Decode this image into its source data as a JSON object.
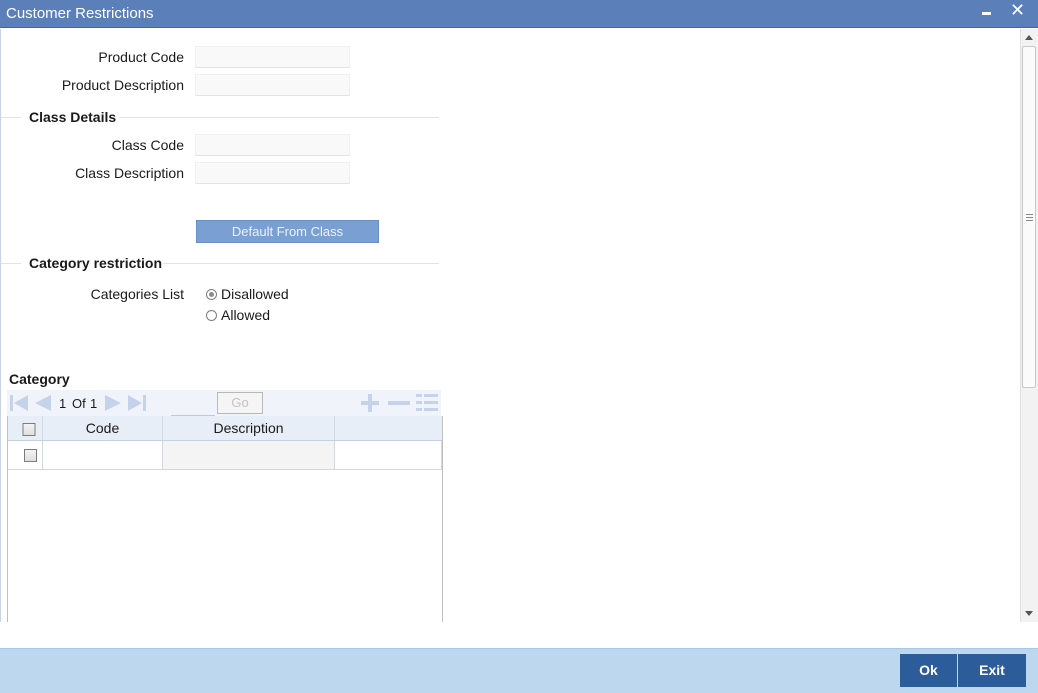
{
  "window": {
    "title": "Customer Restrictions",
    "minimize_icon": "minimize-icon",
    "close_icon": "close-icon",
    "close_glyph": "✕"
  },
  "product": {
    "code_label": "Product Code",
    "code_value": "",
    "description_label": "Product Description",
    "description_value": ""
  },
  "class_details": {
    "section_title": "Class Details",
    "code_label": "Class Code",
    "code_value": "",
    "description_label": "Class Description",
    "description_value": "",
    "default_button_label": "Default From Class"
  },
  "category_restriction": {
    "section_title": "Category restriction",
    "list_label": "Categories List",
    "options": [
      {
        "label": "Disallowed",
        "selected": true
      },
      {
        "label": "Allowed",
        "selected": false
      }
    ]
  },
  "category_grid": {
    "title": "Category",
    "pager": {
      "current": "1",
      "of_label": "Of",
      "total": "1",
      "page_input": "",
      "go_label": "Go"
    },
    "icons": [
      "first-page-icon",
      "previous-page-icon",
      "next-page-icon",
      "last-page-icon",
      "add-row-icon",
      "delete-row-icon",
      "single-view-icon"
    ],
    "columns": [
      "Code",
      "Description"
    ],
    "rows": [
      {
        "code": "",
        "description": ""
      }
    ]
  },
  "footer": {
    "ok_label": "Ok",
    "exit_label": "Exit"
  },
  "colors": {
    "title_bar": "#5a7fb9",
    "footer_bar": "#bdd7ee",
    "footer_button": "#2c5c9a",
    "disabled_button": "#7a9fd3"
  }
}
